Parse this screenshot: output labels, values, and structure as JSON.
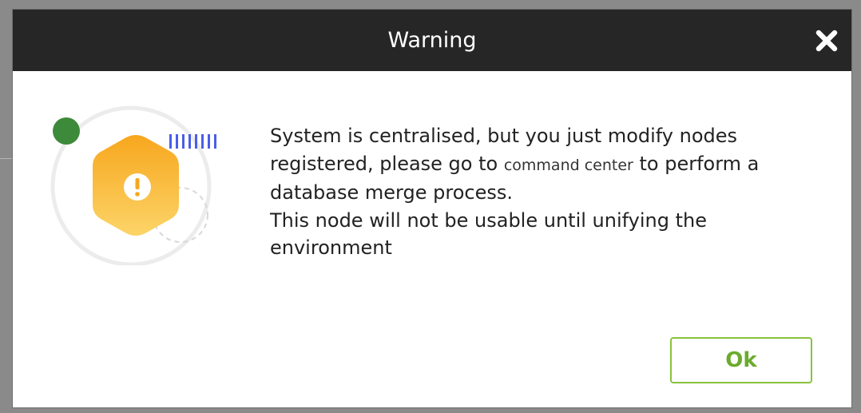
{
  "dialog": {
    "title": "Warning",
    "close_icon": "close-icon",
    "illustration_icon": "warning-hexagon-icon",
    "message": {
      "line1_before": "System is centralised, but you just modify nodes registered, please go to",
      "link_text": "command center",
      "line1_after": "to perform a database merge process.",
      "line2": "This node will not be usable until unifying the environment"
    },
    "ok_label": "Ok"
  },
  "colors": {
    "header_bg": "#262626",
    "accent_green": "#8ac23d",
    "warning_orange": "#f9a825",
    "dot_green": "#3f8f3f",
    "stripes_blue": "#4a5ee8"
  }
}
